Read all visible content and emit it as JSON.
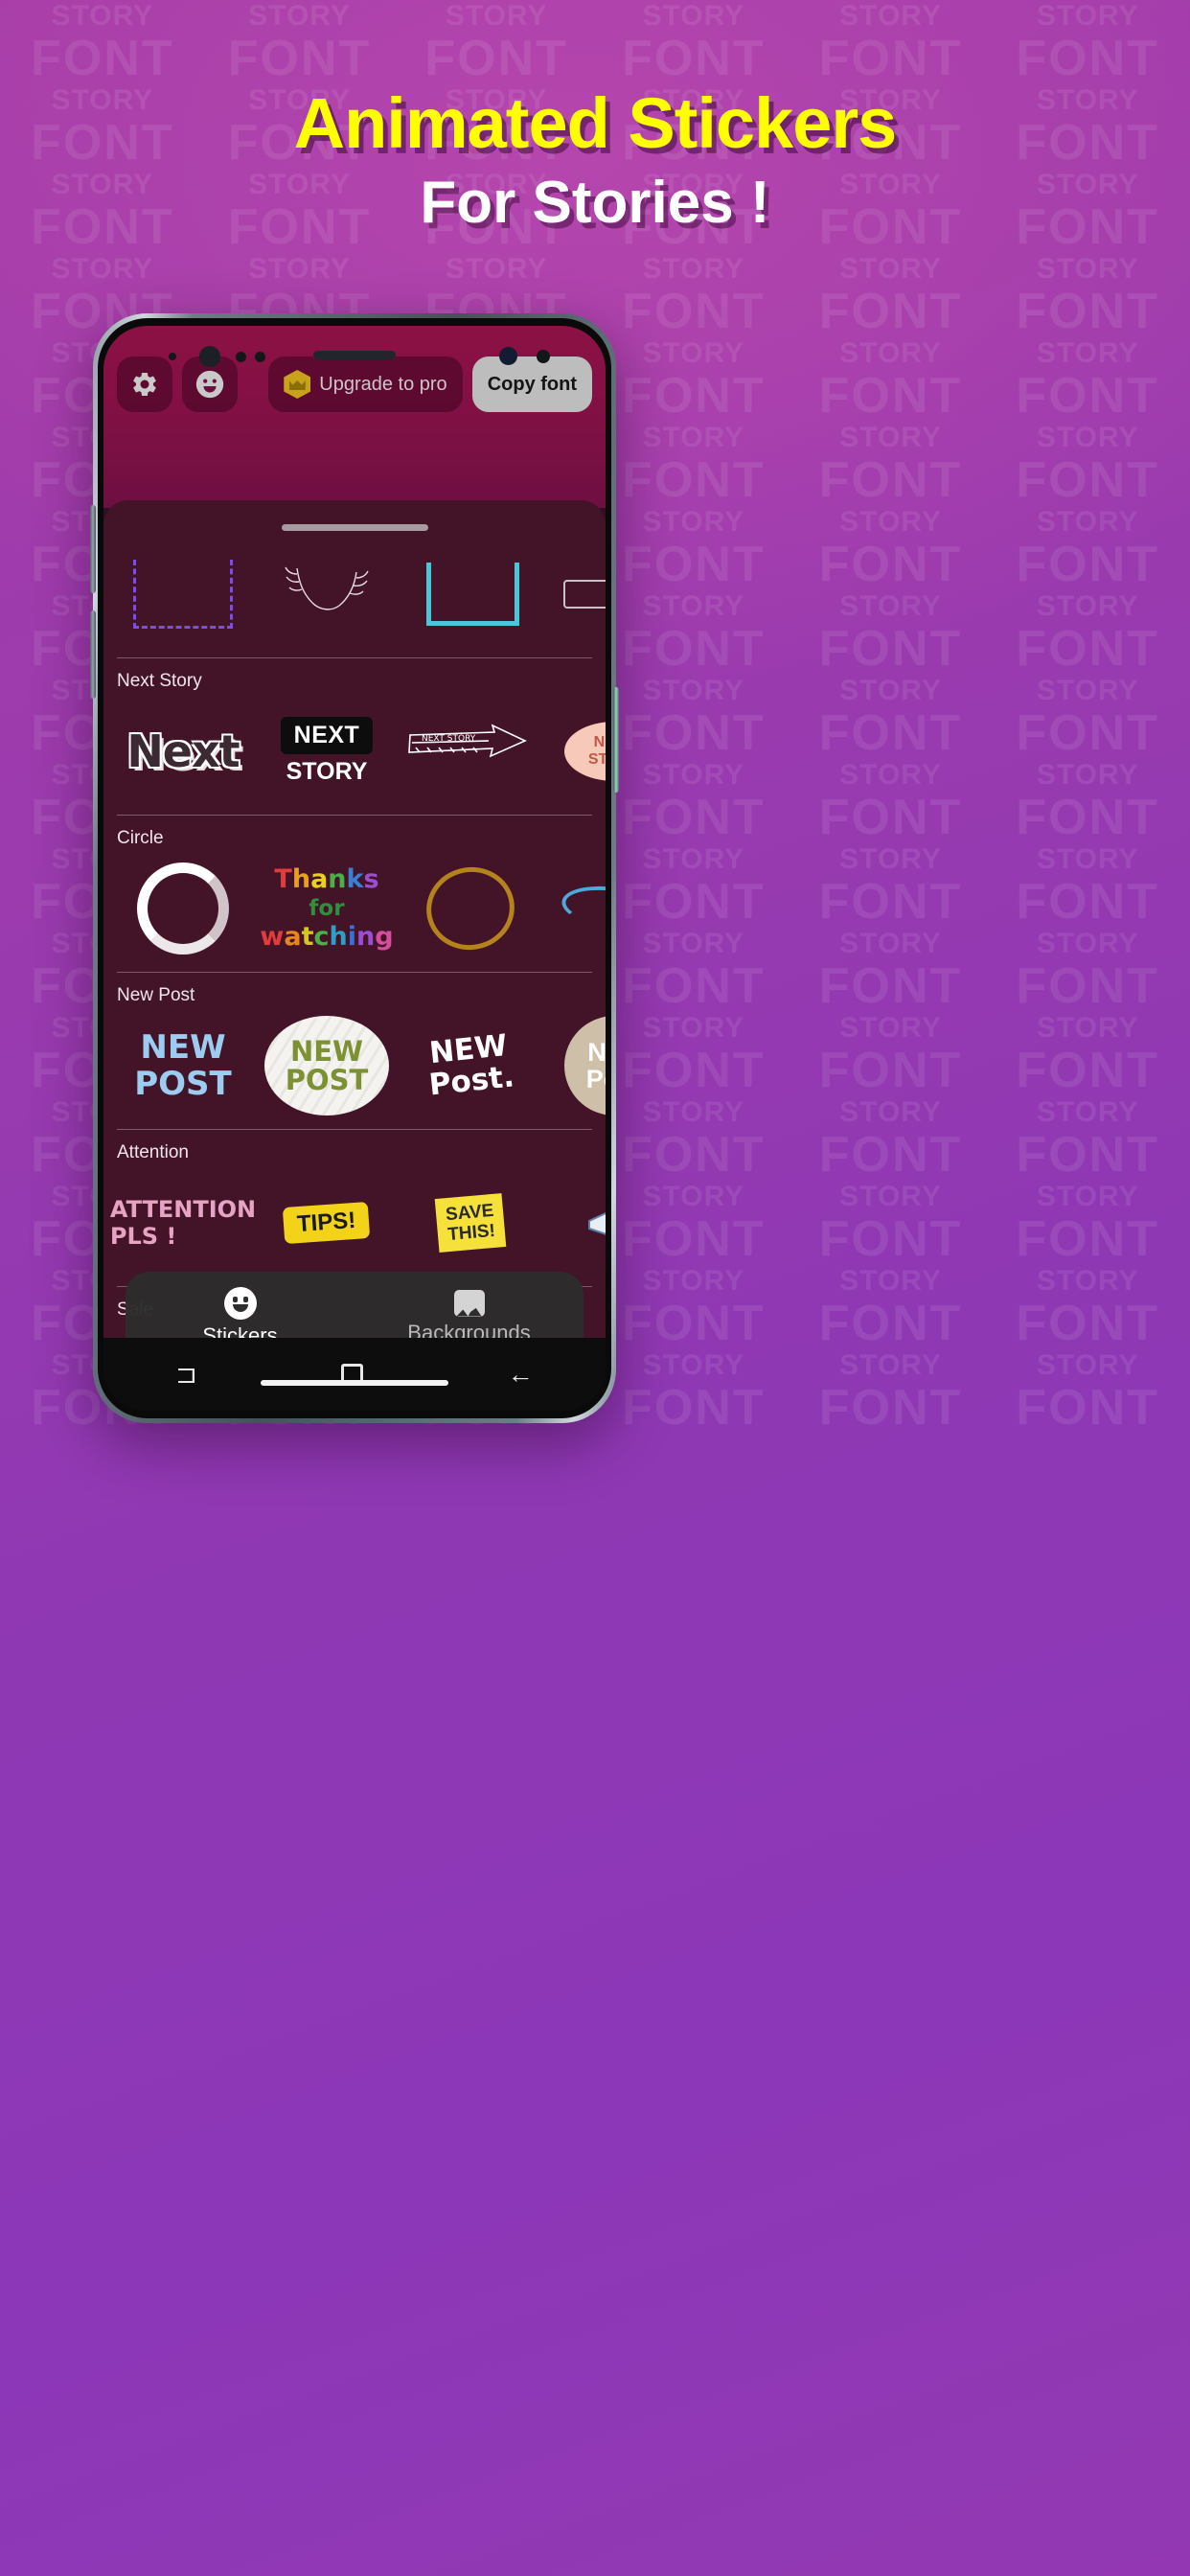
{
  "promo": {
    "headline_line1": "Animated Stickers",
    "headline_line2": "For Stories !",
    "headline_color_1": "#ffff00",
    "headline_color_2": "#ffffff",
    "background_watermark_line1": "STORY",
    "background_watermark_line2": "FONT",
    "background_color": "#9c3bae"
  },
  "app": {
    "header": {
      "settings_icon": "gear-icon",
      "emoji_icon": "smiley-icon",
      "upgrade_label": "Upgrade to pro",
      "upgrade_icon": "crown-icon",
      "copy_font_label": "Copy font",
      "header_color": "#82104 5",
      "copy_button_color": "#bdbdbd"
    },
    "sheet": {
      "grabber": "drag-handle",
      "background_color": "#431428",
      "categories": [
        {
          "title": "",
          "stickers": [
            {
              "name": "dashed-frame-purple",
              "text": ""
            },
            {
              "name": "leaf-branch-frame",
              "text": ""
            },
            {
              "name": "teal-corner-frame",
              "text": ""
            },
            {
              "name": "outline-box-frame",
              "text": ""
            }
          ]
        },
        {
          "title": "Next Story",
          "stickers": [
            {
              "name": "next-bold-word",
              "text": "Next"
            },
            {
              "name": "next-story-black-box",
              "text": "NEXT",
              "text2": "STORY"
            },
            {
              "name": "next-story-sketch-arrow",
              "text": "NEXT STORY"
            },
            {
              "name": "next-story-peach-pill",
              "text": "NEXT",
              "text2": "STORY"
            }
          ]
        },
        {
          "title": "Circle",
          "stickers": [
            {
              "name": "white-brush-circle",
              "text": ""
            },
            {
              "name": "thanks-for-watching",
              "text": "Thanks",
              "text2": "for",
              "text3": "watching"
            },
            {
              "name": "gold-circle-scribble",
              "text": ""
            },
            {
              "name": "blue-swoosh-circle",
              "text": ""
            }
          ]
        },
        {
          "title": "New Post",
          "stickers": [
            {
              "name": "new-post-blue",
              "text": "NEW",
              "text2": "POST"
            },
            {
              "name": "new-post-scribble-green",
              "text": "NEW",
              "text2": "POST"
            },
            {
              "name": "new-post-white-brush",
              "text": "NEW",
              "text2": "Post."
            },
            {
              "name": "new-post-beige-circle",
              "text": "New",
              "text2": "Post"
            }
          ]
        },
        {
          "title": "Attention",
          "stickers": [
            {
              "name": "attention-pls-pink",
              "text": "ATTENTION",
              "text2": "PLS !"
            },
            {
              "name": "tips-yellow-tag",
              "text": "TIPS!"
            },
            {
              "name": "save-this-yellow-note",
              "text": "SAVE",
              "text2": "THIS!"
            },
            {
              "name": "megaphone-sticker",
              "text": ""
            }
          ]
        },
        {
          "title": "Sale",
          "stickers": []
        }
      ]
    },
    "tabbar": {
      "tabs": [
        {
          "label": "Stickers",
          "icon": "smiley-icon",
          "active": true
        },
        {
          "label": "Backgrounds",
          "icon": "image-icon",
          "active": false
        }
      ],
      "active_indicator_color": "#d7f233",
      "background_color": "#2d2d2d"
    },
    "navbar": {
      "recents_icon": "recents-icon",
      "home_icon": "home-square-icon",
      "back_icon": "back-arrow-icon"
    }
  }
}
